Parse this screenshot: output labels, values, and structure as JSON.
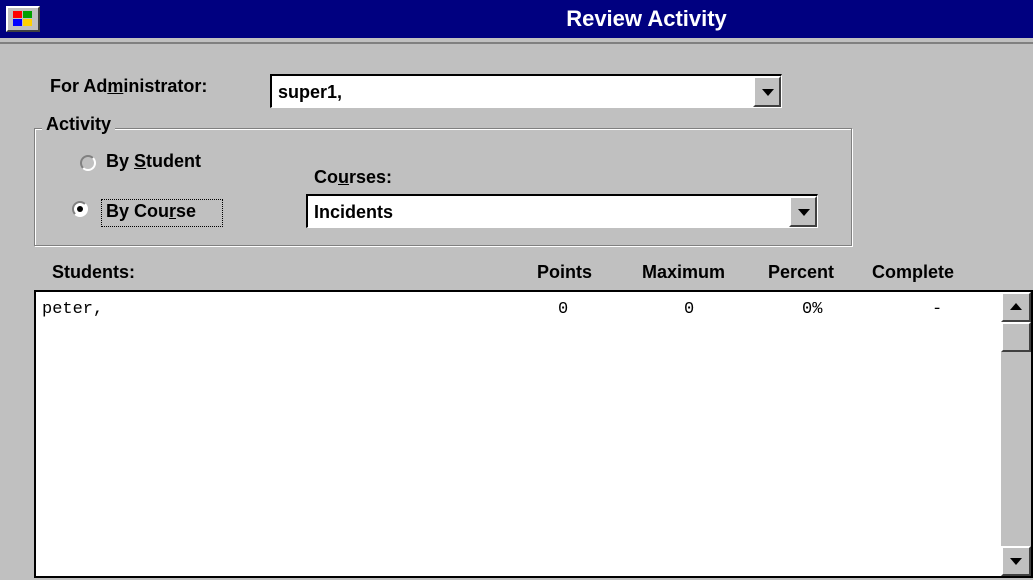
{
  "window": {
    "title": "Review Activity"
  },
  "administrator": {
    "label_pre": "For Ad",
    "label_accel": "m",
    "label_post": "inistrator:",
    "value": "super1,"
  },
  "activity": {
    "group_title": "Activity",
    "by_student": {
      "pre": "By ",
      "accel": "S",
      "post": "tudent",
      "selected": false
    },
    "by_course": {
      "pre": "By Cou",
      "accel": "r",
      "post": "se",
      "selected": true
    },
    "courses_label": {
      "pre": "Co",
      "accel": "u",
      "post": "rses:"
    },
    "courses_value": "Incidents"
  },
  "table": {
    "headers": {
      "students": "Students:",
      "points": "Points",
      "maximum": "Maximum",
      "percent": "Percent",
      "complete": "Complete"
    },
    "rows": [
      {
        "student": "peter,",
        "points": "0",
        "maximum": "0",
        "percent": "0%",
        "complete": "-"
      }
    ]
  },
  "colors": {
    "titlebar": "#000080",
    "window_bg": "#c0c0c0"
  }
}
